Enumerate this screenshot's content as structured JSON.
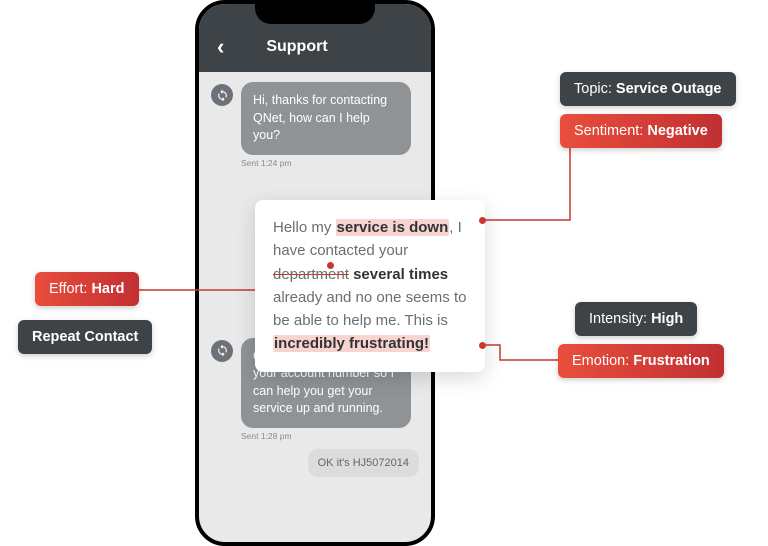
{
  "phone": {
    "header_title": "Support",
    "messages": {
      "m1": "Hi, thanks for contacting QNet, how can I help you?",
      "m1_time": "Sent 1:24 pm",
      "m2_time": "Sent 1:28 pm",
      "m3": "Oh I'm sorry! Let me get your account number so I can help you get your service up and running.",
      "m4": "OK it's HJ5072014"
    }
  },
  "card": {
    "t1": "Hello my ",
    "t2": "service is down",
    "t3": ", I have contacted your ",
    "t4": "department",
    "t5": " ",
    "t6": "several times",
    "t7": " already and no one seems to be able to help me. This is ",
    "t8": "incredibly frustrating!"
  },
  "tags": {
    "topic_l": "Topic: ",
    "topic_v": "Service Outage",
    "sent_l": "Sentiment: ",
    "sent_v": "Negative",
    "effort_l": "Effort: ",
    "effort_v": "Hard",
    "repeat": "Repeat Contact",
    "intens_l": "Intensity: ",
    "intens_v": "High",
    "emo_l": "Emotion: ",
    "emo_v": "Frustration"
  }
}
